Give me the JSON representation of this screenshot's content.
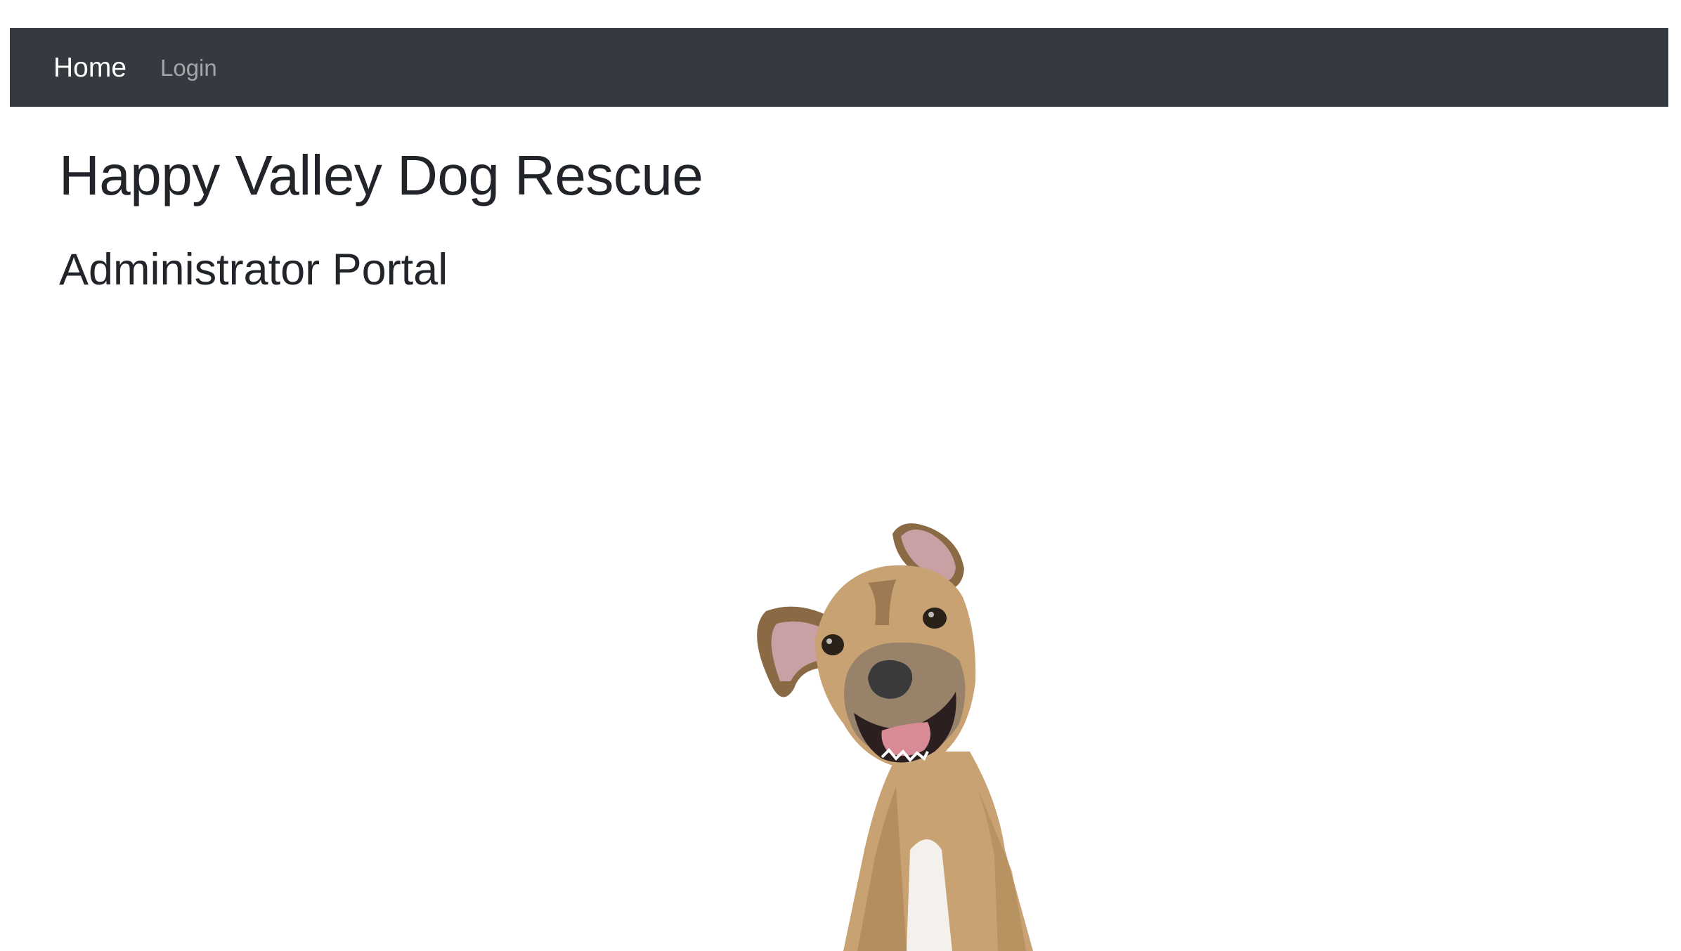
{
  "navbar": {
    "items": [
      {
        "label": "Home",
        "active": true
      },
      {
        "label": "Login",
        "active": false
      }
    ],
    "background": "#343a40"
  },
  "main": {
    "title": "Happy Valley Dog Rescue",
    "subtitle": "Administrator Portal"
  },
  "hero_image": {
    "subject": "dog-photo",
    "colors": {
      "fur": "#c9a273",
      "fur_dark": "#8a6a45",
      "chest": "#f4f1ec",
      "ear_inner": "#c9a0a3",
      "nose": "#3a3a3c",
      "tongue": "#d98b95"
    }
  }
}
